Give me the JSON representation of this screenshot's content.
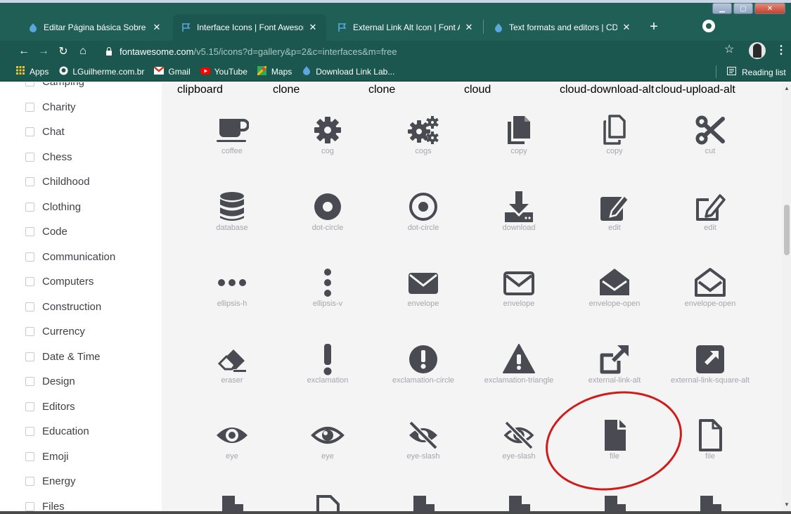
{
  "browser": {
    "tabs": [
      {
        "title": "Editar Página básica Sobre a L",
        "favicon": "drupal-icon",
        "active": false
      },
      {
        "title": "Interface Icons | Font Awesom",
        "favicon": "fontawesome-flag-icon",
        "active": true
      },
      {
        "title": "External Link Alt Icon | Font A",
        "favicon": "fontawesome-flag-icon",
        "active": false
      },
      {
        "title": "Text formats and editors | CDF",
        "favicon": "drupal-icon",
        "active": false
      }
    ],
    "close_glyph": "✕",
    "newtab_glyph": "+",
    "url_host": "fontawesome.com",
    "url_path": "/v5.15/icons?d=gallery&p=2&c=interfaces&m=free",
    "bookmarks": [
      {
        "label": "Apps",
        "icon": "apps-grid-icon"
      },
      {
        "label": "LGuilherme.com.br",
        "icon": "github-icon"
      },
      {
        "label": "Gmail",
        "icon": "gmail-icon"
      },
      {
        "label": "YouTube",
        "icon": "youtube-icon"
      },
      {
        "label": "Maps",
        "icon": "maps-icon"
      },
      {
        "label": "Download Link Lab...",
        "icon": "drupal-icon"
      }
    ],
    "reading_list": "Reading list"
  },
  "sidebar": {
    "categories": [
      "Camping",
      "Charity",
      "Chat",
      "Chess",
      "Childhood",
      "Clothing",
      "Code",
      "Communication",
      "Computers",
      "Construction",
      "Currency",
      "Date & Time",
      "Design",
      "Editors",
      "Education",
      "Emoji",
      "Energy",
      "Files"
    ]
  },
  "gallery": {
    "top_partial_labels": [
      "clipboard",
      "clone",
      "clone",
      "cloud",
      "cloud-download-alt",
      "cloud-upload-alt"
    ],
    "rows": [
      [
        "coffee",
        "cog",
        "cogs",
        "copy",
        "copy",
        "cut"
      ],
      [
        "database",
        "dot-circle",
        "dot-circle",
        "download",
        "edit",
        "edit"
      ],
      [
        "ellipsis-h",
        "ellipsis-v",
        "envelope",
        "envelope",
        "envelope-open",
        "envelope-open"
      ],
      [
        "eraser",
        "exclamation",
        "exclamation-circle",
        "exclamation-triangle",
        "external-link-alt",
        "external-link-square-alt"
      ],
      [
        "eye",
        "eye",
        "eye-slash",
        "eye-slash",
        "file",
        "file"
      ]
    ],
    "highlighted": "external-link-alt",
    "icon_color": "#4a4b52",
    "label_color": "#a6a6ad",
    "annotation_color": "#d11a1a"
  },
  "colors": {
    "titlebar": "#1f5f56",
    "toolbar": "#1b574e"
  }
}
